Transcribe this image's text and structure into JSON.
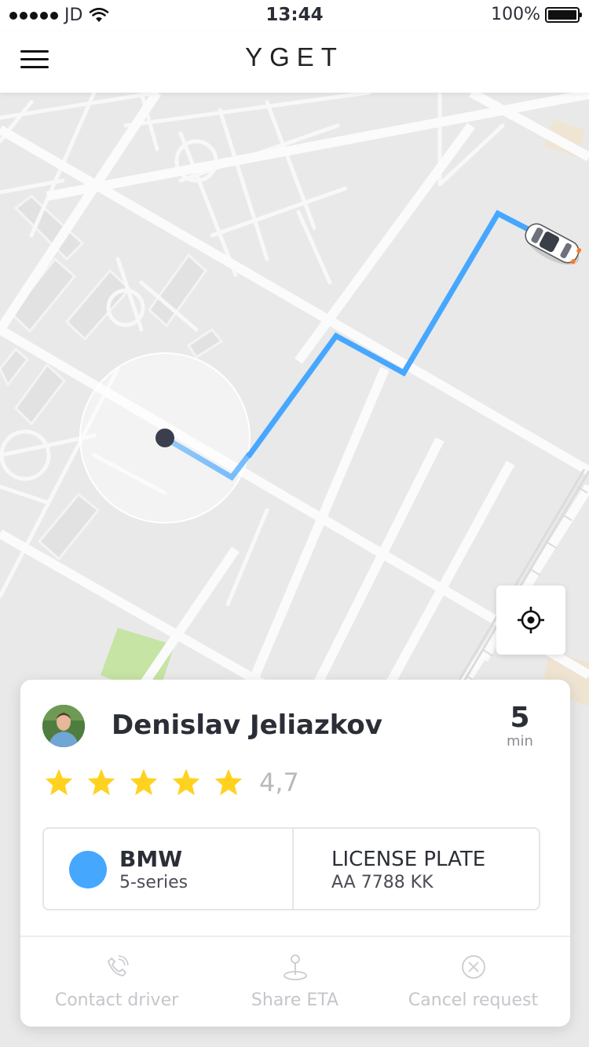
{
  "status_bar": {
    "carrier": "JD",
    "time": "13:44",
    "battery": "100%",
    "icons": [
      "signal-dots-icon",
      "wifi-icon",
      "battery-icon"
    ]
  },
  "header": {
    "brand": "YGET",
    "menu_icon": "hamburger-menu-icon"
  },
  "map": {
    "route_color": "#46a7ff",
    "locate_icon": "locate-crosshair-icon",
    "markers": [
      "user-location-marker",
      "car-marker"
    ]
  },
  "driver_card": {
    "name": "Denislav Jeliazkov",
    "eta_value": "5",
    "eta_unit": "min",
    "rating_stars": 5,
    "rating": "4,7",
    "star_color": "#ffd21f",
    "car": {
      "make": "BMW",
      "model": "5-series",
      "color": "#46a7ff"
    },
    "plate": {
      "label": "LICENSE PLATE",
      "value": "AA 7788 KK"
    },
    "actions": [
      {
        "label": "Contact driver",
        "icon": "phone-icon"
      },
      {
        "label": "Share ETA",
        "icon": "location-pin-icon"
      },
      {
        "label": "Cancel request",
        "icon": "close-circle-icon"
      }
    ]
  }
}
